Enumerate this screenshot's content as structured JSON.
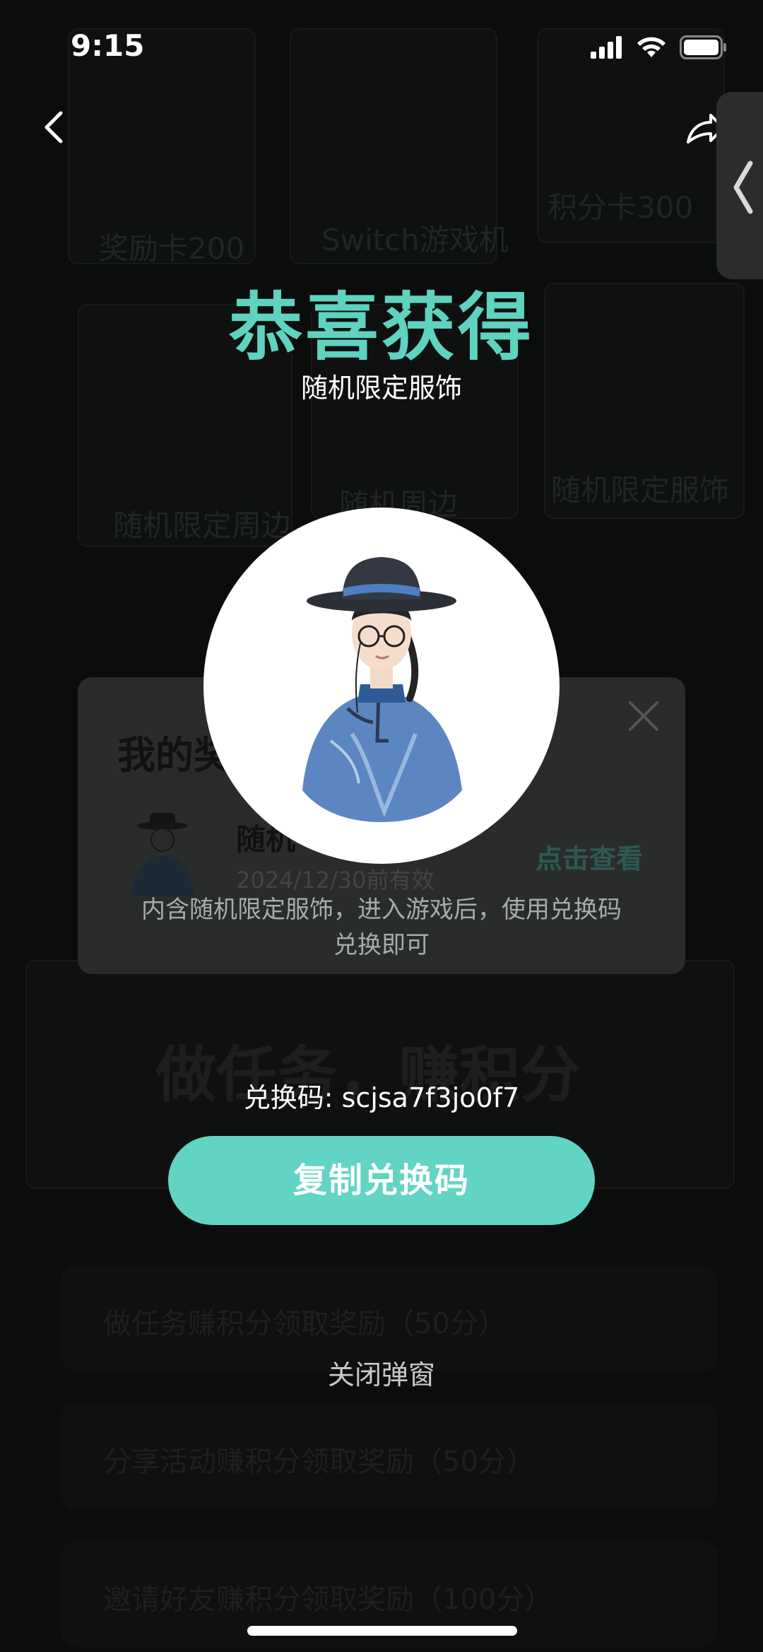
{
  "status_bar": {
    "time": "9:15"
  },
  "icons": {
    "back": "chevron-left-icon",
    "share": "share-icon",
    "side_tab": "chevron-left-icon",
    "close": "close-icon",
    "signal": "signal-icon",
    "wifi": "wifi-icon",
    "battery": "battery-icon"
  },
  "background": {
    "cards": [
      "奖励卡200",
      "Switch游戏机",
      "积分卡300",
      "随机限定周边",
      "随机周边",
      "随机限定服饰"
    ],
    "heading": "做任务，赚积分",
    "rows": [
      "做任务赚积分领取奖励（50分）",
      "分享活动赚积分领取奖励（50分）",
      "邀请好友赚积分领取奖励（100分）"
    ]
  },
  "popup": {
    "title": "恭喜获得",
    "subtitle": "随机限定服饰",
    "description": "内含随机限定服饰，进入游戏后，使用兑换码兑换即可",
    "redeem_code": "兑换码: scjsa7f3jo0f7",
    "copy_button": "复制兑换码",
    "close_button": "关闭弹窗"
  },
  "my_prize_card": {
    "title": "我的奖",
    "item_name": "随机",
    "item_date": "2024/12/30前有效",
    "view_link": "点击查看"
  },
  "colors": {
    "accent": "#5fd2c0",
    "button": "#62d4c3",
    "overlay": "#0b0c0c"
  }
}
